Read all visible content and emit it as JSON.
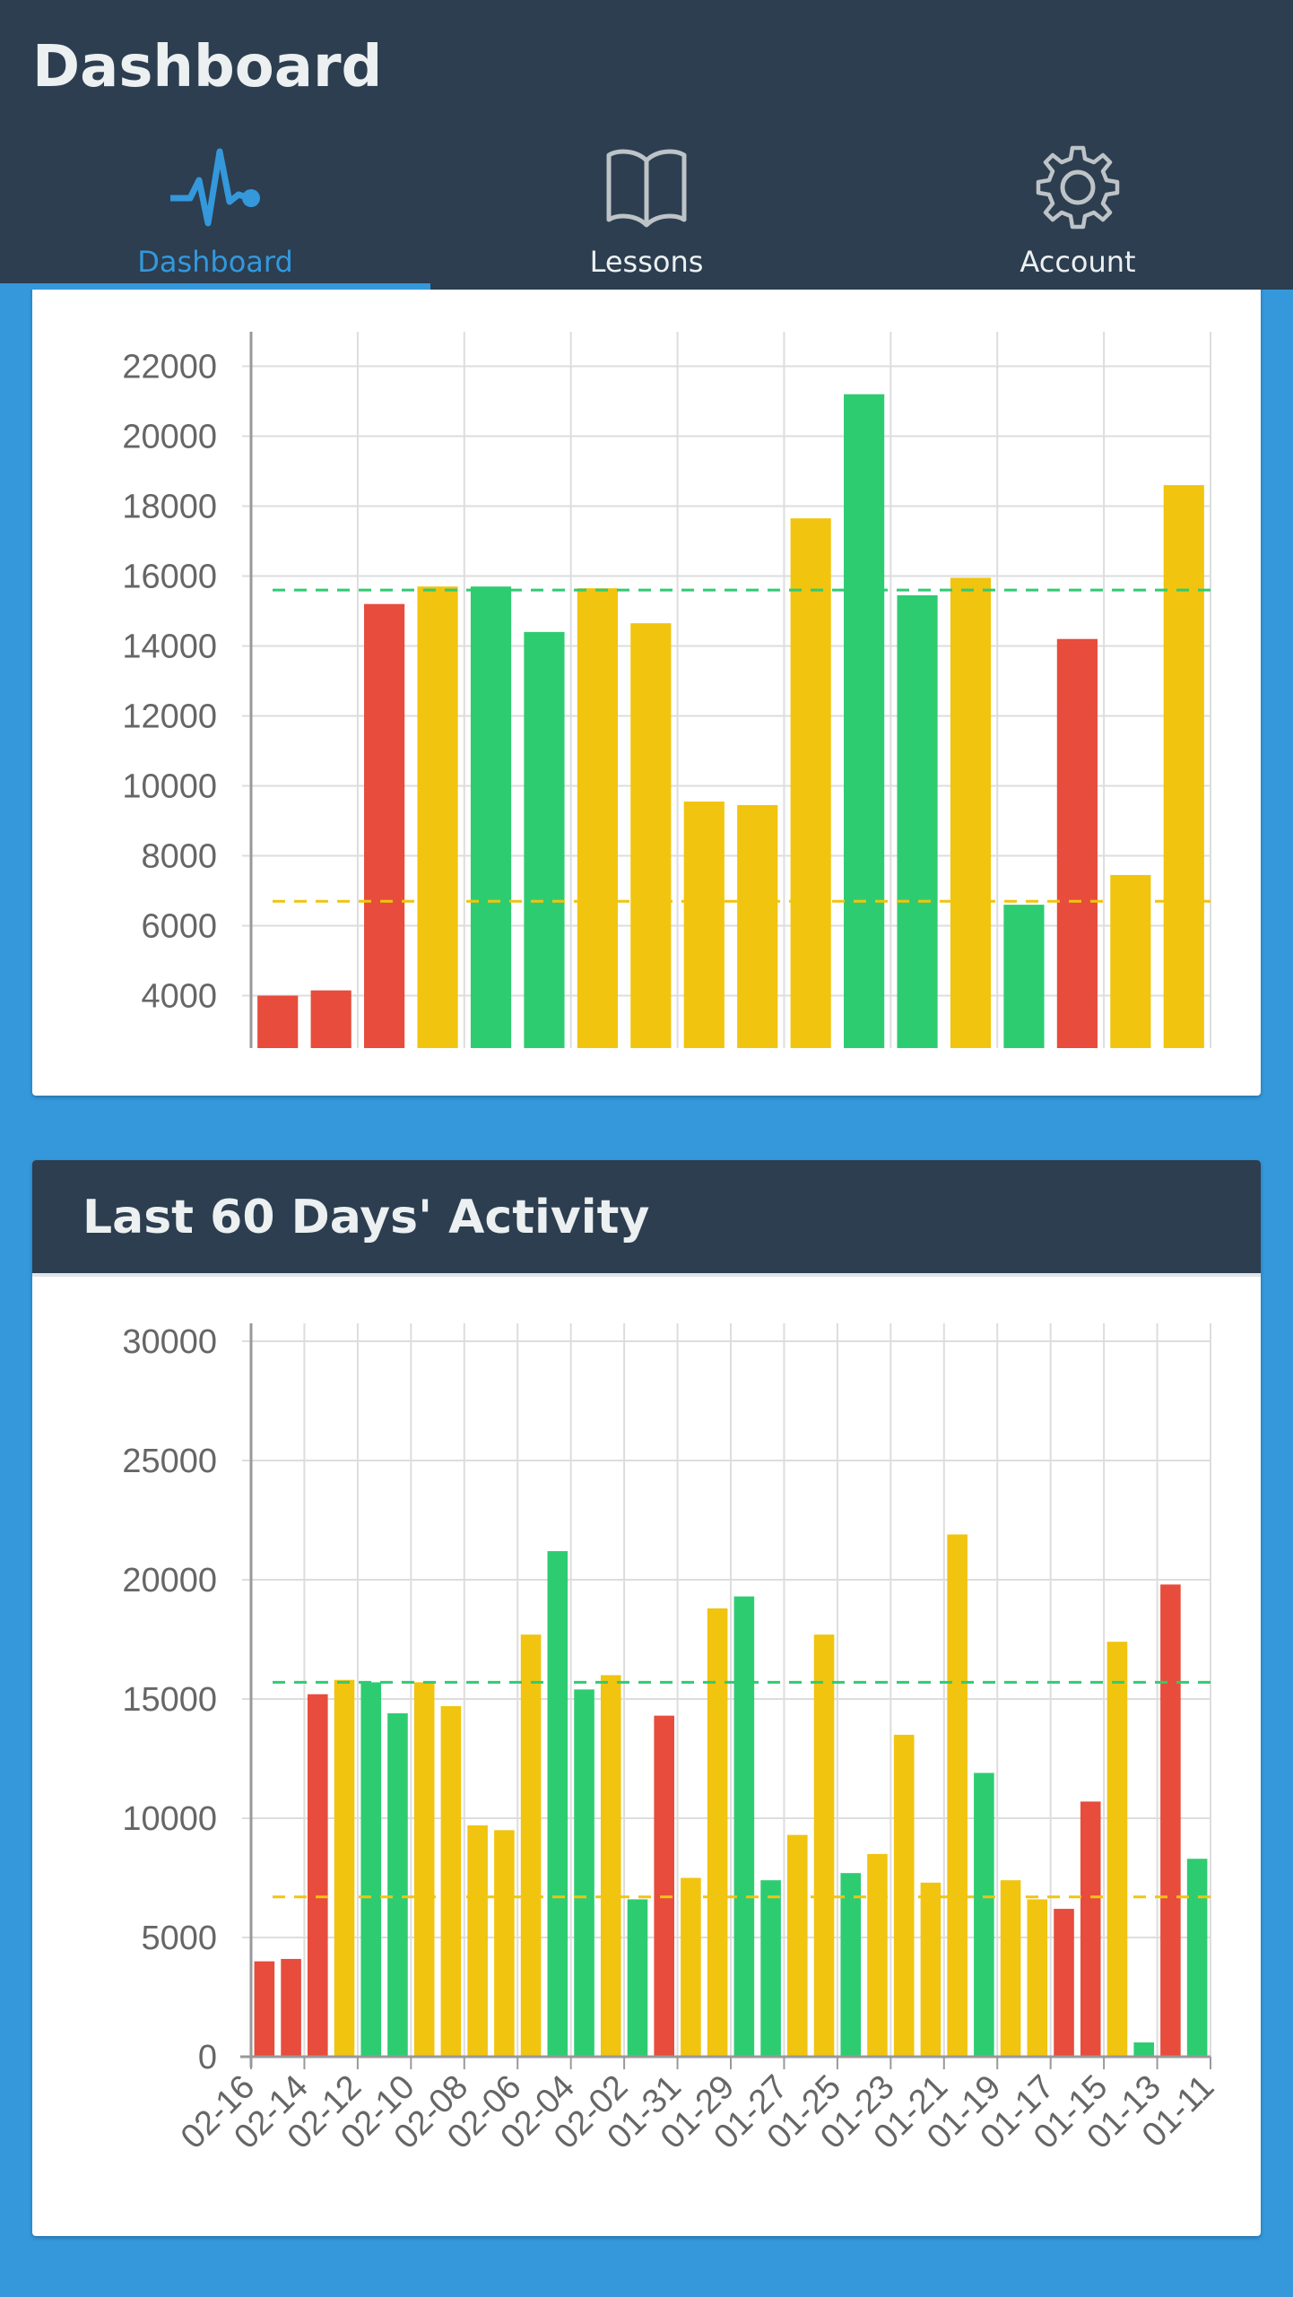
{
  "header": {
    "title": "Dashboard",
    "tabs": [
      {
        "label": "Dashboard",
        "icon": "activity-pulse-icon",
        "active": true
      },
      {
        "label": "Lessons",
        "icon": "book-icon",
        "active": false
      },
      {
        "label": "Account",
        "icon": "gear-icon",
        "active": false
      }
    ]
  },
  "colors": {
    "header_bg": "#2c3e50",
    "page_bg": "#3498db",
    "active_tab": "#3498db",
    "bar_red": "#e74c3c",
    "bar_yellow": "#f1c40f",
    "bar_green": "#2ecc71"
  },
  "chart_data": [
    {
      "type": "bar",
      "title": "",
      "xlabel": "",
      "ylabel": "",
      "ylim": [
        2500,
        22500
      ],
      "yticks": [
        4000,
        6000,
        8000,
        10000,
        12000,
        14000,
        16000,
        18000,
        20000,
        22000
      ],
      "grid": true,
      "reference_lines": [
        {
          "value": 15600,
          "color": "#2ecc71",
          "style": "dashed"
        },
        {
          "value": 6700,
          "color": "#f1c40f",
          "style": "dashed"
        }
      ],
      "values": [
        4000,
        4150,
        15200,
        15700,
        15700,
        14400,
        15650,
        14650,
        9550,
        9450,
        17650,
        21200,
        15450,
        15950,
        6600,
        14200,
        7450,
        18600
      ],
      "colors": [
        "red",
        "red",
        "red",
        "yellow",
        "green",
        "green",
        "yellow",
        "yellow",
        "yellow",
        "yellow",
        "yellow",
        "green",
        "green",
        "yellow",
        "green",
        "red",
        "yellow",
        "yellow"
      ]
    },
    {
      "type": "bar",
      "title": "Last 60 Days' Activity",
      "xlabel": "",
      "ylabel": "",
      "ylim": [
        0,
        30000
      ],
      "yticks": [
        0,
        5000,
        10000,
        15000,
        20000,
        25000,
        30000
      ],
      "grid": true,
      "reference_lines": [
        {
          "value": 15700,
          "color": "#2ecc71",
          "style": "dashed"
        },
        {
          "value": 6700,
          "color": "#f1c40f",
          "style": "dashed"
        }
      ],
      "x_tick_labels": [
        "02-16",
        "02-14",
        "02-12",
        "02-10",
        "02-08",
        "02-06",
        "02-04",
        "02-02",
        "01-31",
        "01-29",
        "01-27",
        "01-25",
        "01-23",
        "01-21",
        "01-19",
        "01-17",
        "01-15",
        "01-13",
        "01-11"
      ],
      "values": [
        4000,
        4100,
        15200,
        15800,
        15700,
        14400,
        15700,
        14700,
        9700,
        9500,
        17700,
        21200,
        15400,
        16000,
        6600,
        14300,
        7500,
        18800,
        19300,
        7400,
        9300,
        17700,
        7700,
        8500,
        13500,
        7300,
        21900,
        11900,
        7400,
        6600,
        6200,
        10700,
        17400,
        600,
        19800,
        8300
      ],
      "colors": [
        "red",
        "red",
        "red",
        "yellow",
        "green",
        "green",
        "yellow",
        "yellow",
        "yellow",
        "yellow",
        "yellow",
        "green",
        "green",
        "yellow",
        "green",
        "red",
        "yellow",
        "yellow",
        "green",
        "green",
        "yellow",
        "yellow",
        "green",
        "yellow",
        "yellow",
        "yellow",
        "yellow",
        "green",
        "yellow",
        "yellow",
        "red",
        "red",
        "yellow",
        "green",
        "red",
        "green"
      ]
    }
  ]
}
